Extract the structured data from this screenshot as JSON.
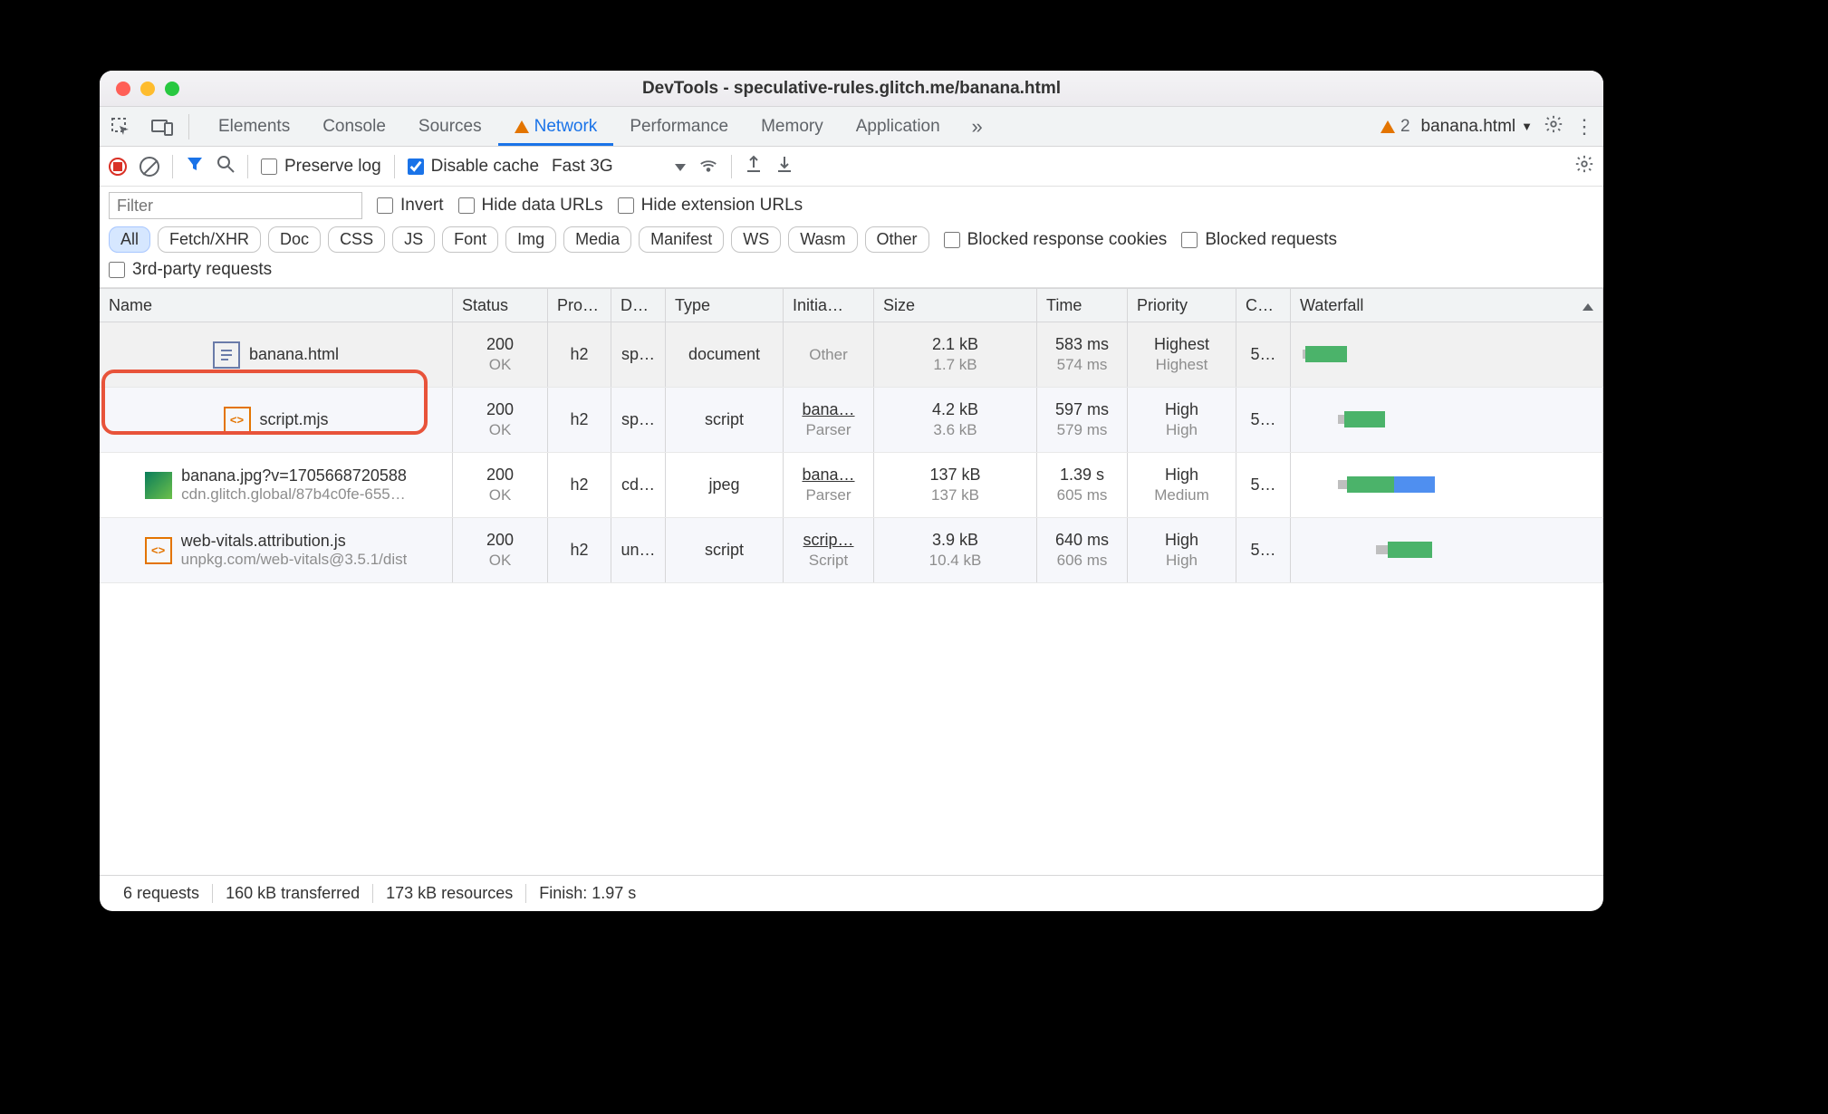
{
  "window": {
    "title": "DevTools - speculative-rules.glitch.me/banana.html"
  },
  "tabs": {
    "items": [
      "Elements",
      "Console",
      "Sources",
      "Network",
      "Performance",
      "Memory",
      "Application"
    ],
    "active": "Network",
    "warn_count": "2",
    "context": "banana.html"
  },
  "toolbar": {
    "preserve_log": "Preserve log",
    "disable_cache": "Disable cache",
    "throttle": "Fast 3G"
  },
  "filters": {
    "placeholder": "Filter",
    "invert": "Invert",
    "hide_data": "Hide data URLs",
    "hide_ext": "Hide extension URLs",
    "chips": [
      "All",
      "Fetch/XHR",
      "Doc",
      "CSS",
      "JS",
      "Font",
      "Img",
      "Media",
      "Manifest",
      "WS",
      "Wasm",
      "Other"
    ],
    "active_chip": "All",
    "blocked_cookies": "Blocked response cookies",
    "blocked_req": "Blocked requests",
    "third_party": "3rd-party requests"
  },
  "columns": {
    "name": "Name",
    "status": "Status",
    "proto": "Pro…",
    "dom": "D…",
    "type": "Type",
    "init": "Initia…",
    "size": "Size",
    "time": "Time",
    "prio": "Priority",
    "conn": "C…",
    "wf": "Waterfall"
  },
  "rows": [
    {
      "icon": "doc",
      "name": "banana.html",
      "sub": "",
      "status": "200",
      "status2": "OK",
      "proto": "h2",
      "dom": "sp…",
      "type": "document",
      "init": "Other",
      "init2": "",
      "init_link": false,
      "size": "2.1 kB",
      "size2": "1.7 kB",
      "time": "583 ms",
      "time2": "574 ms",
      "prio": "Highest",
      "prio2": "Highest",
      "conn": "5…",
      "wf": [
        {
          "cls": "wait thin",
          "l": 1,
          "w": 1
        },
        {
          "cls": "dl",
          "l": 2,
          "w": 14
        }
      ]
    },
    {
      "icon": "js",
      "name": "script.mjs",
      "sub": "",
      "status": "200",
      "status2": "OK",
      "proto": "h2",
      "dom": "sp…",
      "type": "script",
      "init": "bana…",
      "init2": "Parser",
      "init_link": true,
      "size": "4.2 kB",
      "size2": "3.6 kB",
      "time": "597 ms",
      "time2": "579 ms",
      "prio": "High",
      "prio2": "High",
      "conn": "5…",
      "wf": [
        {
          "cls": "wait thin",
          "l": 13,
          "w": 2
        },
        {
          "cls": "dl",
          "l": 15,
          "w": 14
        }
      ]
    },
    {
      "icon": "img",
      "name": "banana.jpg?v=1705668720588",
      "sub": "cdn.glitch.global/87b4c0fe-655…",
      "status": "200",
      "status2": "OK",
      "proto": "h2",
      "dom": "cd…",
      "type": "jpeg",
      "init": "bana…",
      "init2": "Parser",
      "init_link": true,
      "size": "137 kB",
      "size2": "137 kB",
      "time": "1.39 s",
      "time2": "605 ms",
      "prio": "High",
      "prio2": "Medium",
      "conn": "5…",
      "wf": [
        {
          "cls": "wait thin",
          "l": 13,
          "w": 3
        },
        {
          "cls": "dl",
          "l": 16,
          "w": 16
        },
        {
          "cls": "blue",
          "l": 32,
          "w": 14
        }
      ]
    },
    {
      "icon": "js",
      "name": "web-vitals.attribution.js",
      "sub": "unpkg.com/web-vitals@3.5.1/dist",
      "status": "200",
      "status2": "OK",
      "proto": "h2",
      "dom": "un…",
      "type": "script",
      "init": "scrip…",
      "init2": "Script",
      "init_link": true,
      "size": "3.9 kB",
      "size2": "10.4 kB",
      "time": "640 ms",
      "time2": "606 ms",
      "prio": "High",
      "prio2": "High",
      "conn": "5…",
      "wf": [
        {
          "cls": "wait thin",
          "l": 26,
          "w": 4
        },
        {
          "cls": "dl",
          "l": 30,
          "w": 15
        }
      ]
    }
  ],
  "status": {
    "requests": "6 requests",
    "transferred": "160 kB transferred",
    "resources": "173 kB resources",
    "finish": "Finish: 1.97 s"
  }
}
